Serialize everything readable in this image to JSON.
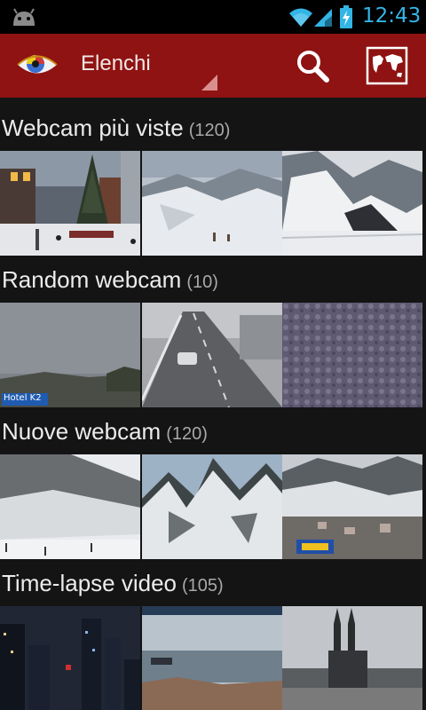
{
  "status_bar": {
    "time": "12:43",
    "icons": [
      "android-debug-icon",
      "wifi-icon",
      "signal-icon",
      "battery-charging-icon"
    ],
    "accent_color": "#33b5e5"
  },
  "action_bar": {
    "title": "Elenchi",
    "background_color": "#8e1312",
    "actions": [
      "search-icon",
      "world-map-icon"
    ]
  },
  "sections": [
    {
      "title": "Webcam più viste",
      "count": "(120)",
      "thumbnails": [
        "christmas-square",
        "snowy-valley",
        "mountain-road"
      ]
    },
    {
      "title": "Random webcam",
      "count": "(10)",
      "thumbnails": [
        "cloudy-sky-hotel-k2",
        "highway-fog",
        "frosted-glass"
      ]
    },
    {
      "title": "Nuove webcam",
      "count": "(120)",
      "thumbnails": [
        "ski-slope",
        "snowy-peaks",
        "alpine-town"
      ]
    },
    {
      "title": "Time-lapse video",
      "count": "(105)",
      "thumbnails": [
        "city-night",
        "harbor-sea",
        "cathedral-city"
      ]
    }
  ],
  "overlay": {
    "hotel_label": "Hotel K2"
  }
}
